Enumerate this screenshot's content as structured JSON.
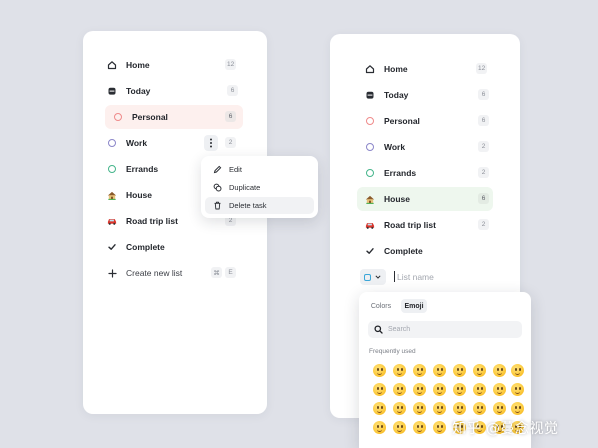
{
  "left_list": {
    "items": [
      {
        "label": "Home",
        "count": "12",
        "icon": "home-icon"
      },
      {
        "label": "Today",
        "count": "6",
        "icon": "inbox-icon"
      },
      {
        "label": "Personal",
        "count": "6",
        "icon": "circle-icon",
        "color": "#ef8a8a"
      },
      {
        "label": "Work",
        "count": "2",
        "icon": "circle-icon",
        "color": "#8b86c9"
      },
      {
        "label": "Errands",
        "count": "",
        "icon": "circle-icon",
        "color": "#45b58b"
      },
      {
        "label": "House",
        "count": "",
        "icon": "house-emoji-icon"
      },
      {
        "label": "Road trip list",
        "count": "2",
        "icon": "car-emoji-icon"
      },
      {
        "label": "Complete",
        "count": "",
        "icon": "checkmark-icon"
      }
    ],
    "create_label": "Create new list",
    "shortcut_mod": "⌘",
    "shortcut_key": "E"
  },
  "context_menu": {
    "items": [
      {
        "label": "Edit",
        "icon": "pencil-icon"
      },
      {
        "label": "Duplicate",
        "icon": "duplicate-icon"
      },
      {
        "label": "Delete task",
        "icon": "trash-icon"
      }
    ]
  },
  "right_list": {
    "items": [
      {
        "label": "Home",
        "count": "12",
        "icon": "home-icon"
      },
      {
        "label": "Today",
        "count": "6",
        "icon": "inbox-icon"
      },
      {
        "label": "Personal",
        "count": "6",
        "icon": "circle-icon",
        "color": "#ef8a8a"
      },
      {
        "label": "Work",
        "count": "2",
        "icon": "circle-icon",
        "color": "#8b86c9"
      },
      {
        "label": "Errands",
        "count": "2",
        "icon": "circle-icon",
        "color": "#45b58b"
      },
      {
        "label": "House",
        "count": "6",
        "icon": "house-emoji-icon"
      },
      {
        "label": "Road trip list",
        "count": "2",
        "icon": "car-emoji-icon"
      },
      {
        "label": "Complete",
        "count": "",
        "icon": "checkmark-icon"
      }
    ],
    "list_name_placeholder": "List name"
  },
  "emoji_picker": {
    "tab_colors": "Colors",
    "tab_emoji": "Emoji",
    "search_placeholder": "Search",
    "section_label": "Frequently used"
  },
  "watermark": "知乎 @蔓念视觉",
  "colors": {
    "personal_highlight": "#fdf0ee",
    "house_highlight": "#eef7ee",
    "delete_highlight": "#f1f2f4"
  }
}
